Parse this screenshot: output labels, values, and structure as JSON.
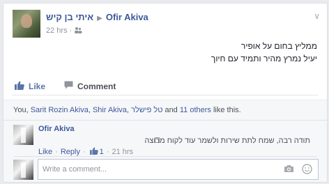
{
  "post": {
    "author": "איתי בן קיש",
    "target": "Ofir Akiva",
    "time": "22 hrs",
    "audience_icon": "friends-icon",
    "menu_icon": "chevron-down-icon",
    "text_lines": [
      "ממליץ בחום על אופיר",
      "יעיל נמרץ מהיר ותמיד עם חיוך"
    ]
  },
  "actions": {
    "like_label": "Like",
    "comment_label": "Comment"
  },
  "likes": {
    "prefix": "You, ",
    "person1": "Sarit Rozin Akiva",
    "sep1": ", ",
    "person2": "Shir Akiva",
    "sep2": ", ",
    "person3": "טל פישלר",
    "middle": " and ",
    "others": "11 others",
    "suffix": " like this."
  },
  "comment": {
    "author": "Ofir Akiva",
    "text": "תודה רבה, שמח לתת שירות ולשמר עוד לקוח מרוצה",
    "like_label": "Like",
    "reply_label": "Reply",
    "like_count": "1",
    "time": "21 hrs"
  },
  "compose": {
    "placeholder": "Write a comment..."
  },
  "colors": {
    "link": "#3b5998",
    "muted": "#90949c",
    "background": "#e9ebee"
  }
}
